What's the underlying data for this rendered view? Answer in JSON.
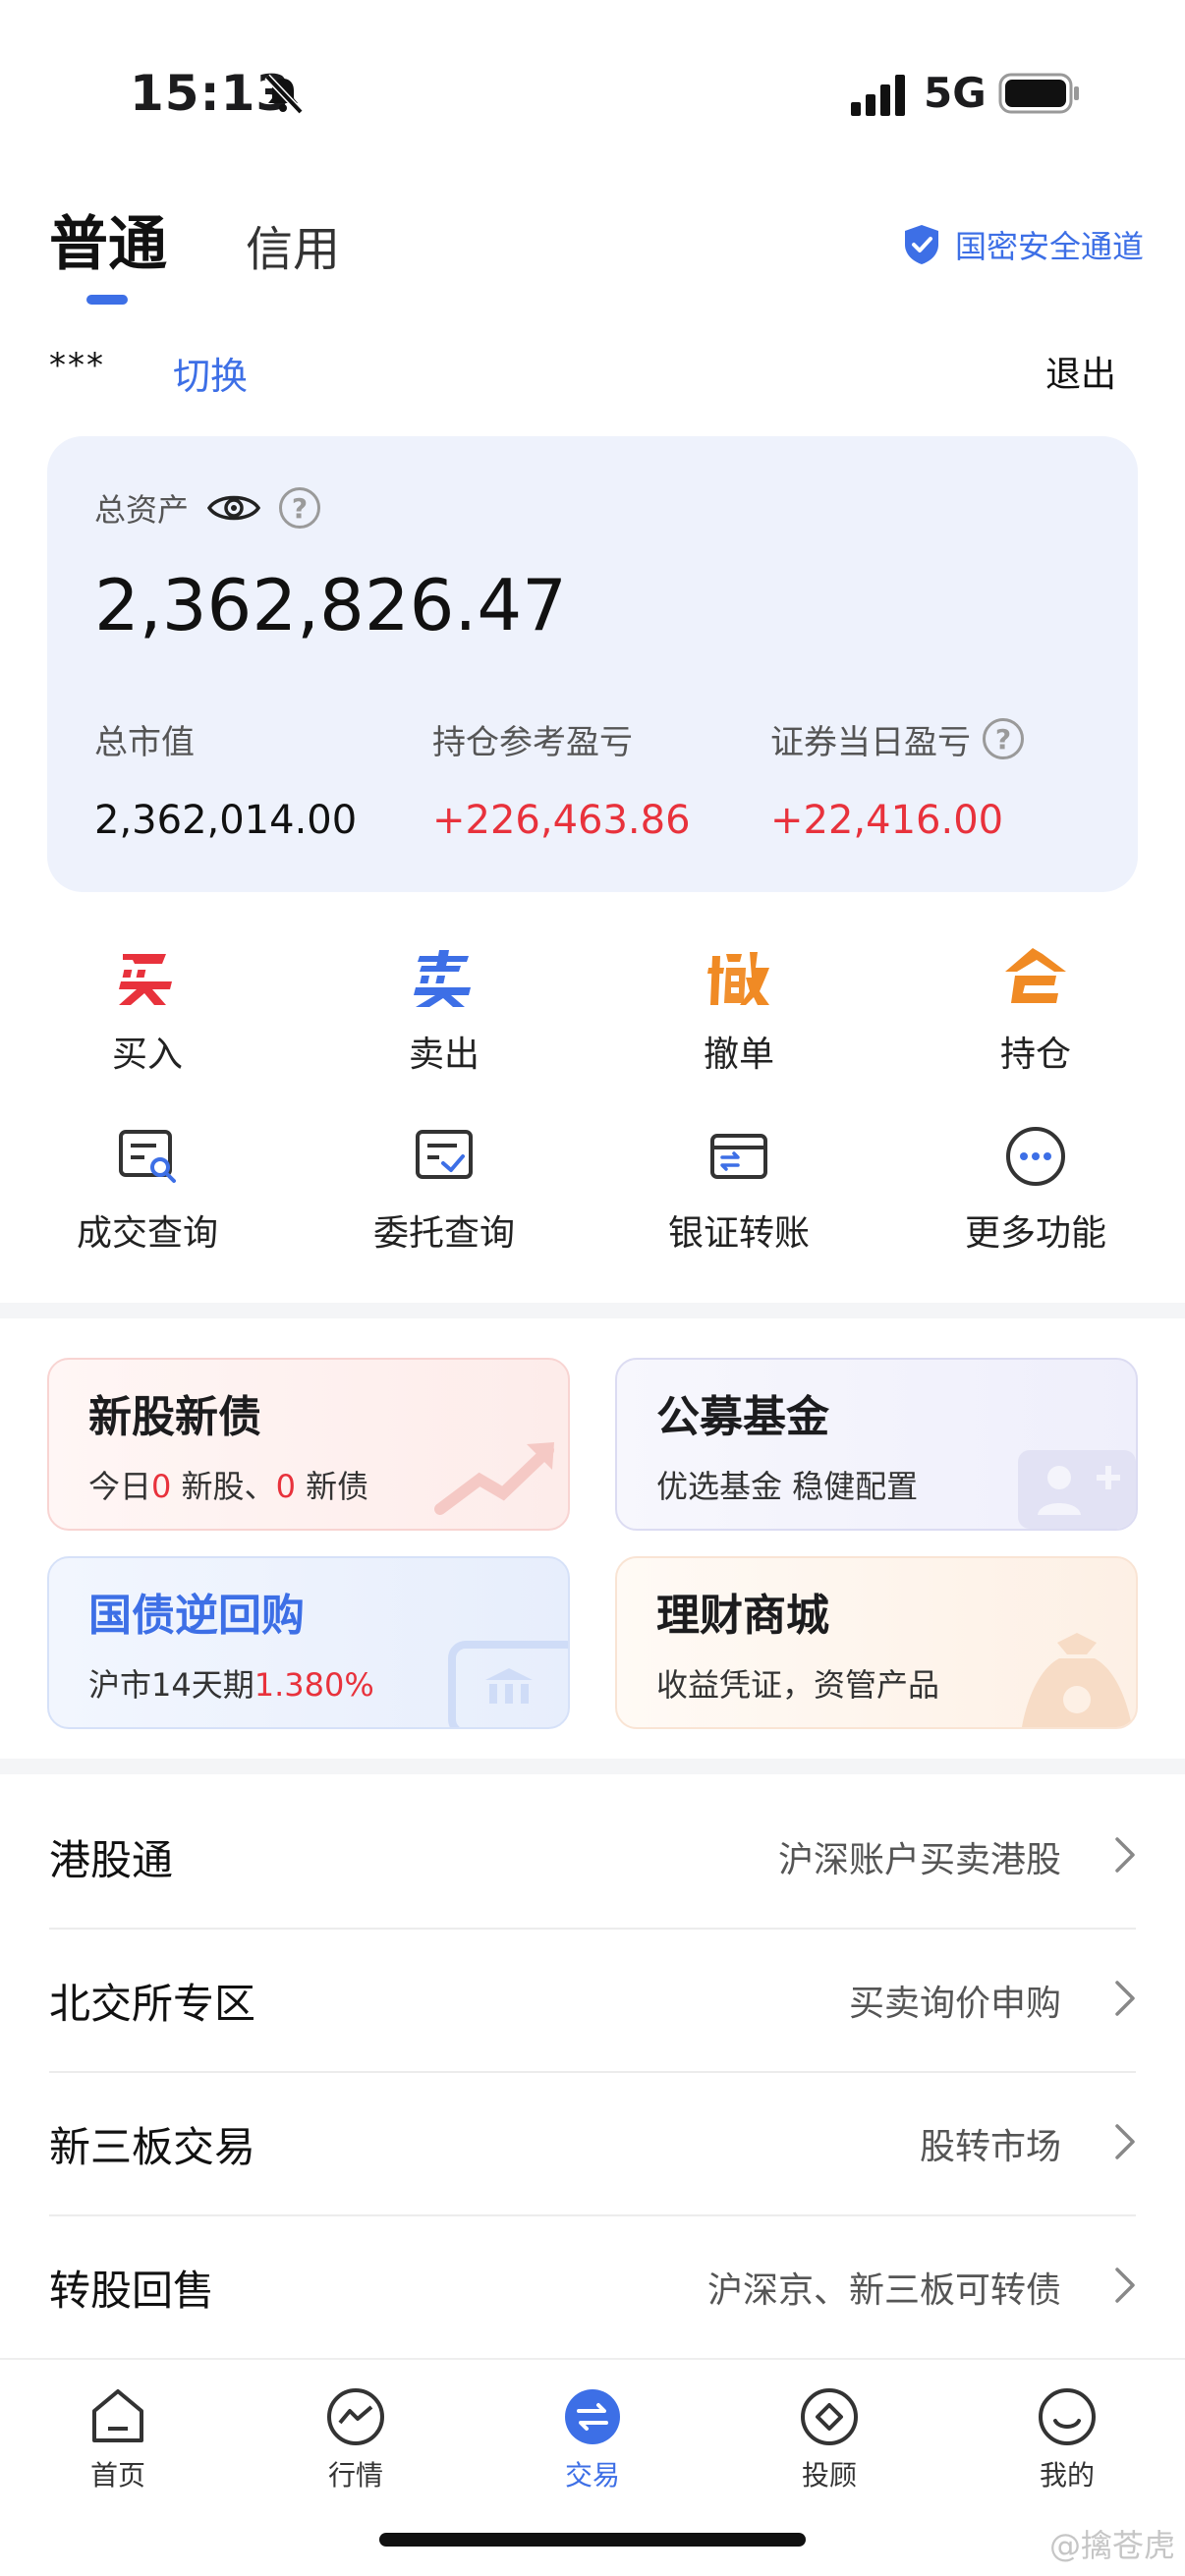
{
  "status_bar": {
    "time": "15:13",
    "network": "5G"
  },
  "tabs": {
    "normal": "普通",
    "credit": "信用"
  },
  "secure_channel": "国密安全通道",
  "account": {
    "masked": "***",
    "switch": "切换",
    "logout": "退出"
  },
  "assets": {
    "total_label": "总资产",
    "total_value": "2,362,826.47",
    "market_value_label": "总市值",
    "market_value": "2,362,014.00",
    "position_pnl_label": "持仓参考盈亏",
    "position_pnl": "+226,463.86",
    "daily_pnl_label": "证券当日盈亏",
    "daily_pnl": "+22,416.00",
    "help": "?"
  },
  "actions_row1": [
    {
      "glyph": "买",
      "label": "买入",
      "color": "#e8323c"
    },
    {
      "glyph": "卖",
      "label": "卖出",
      "color": "#3d6fe6"
    },
    {
      "glyph": "撤",
      "label": "撤单",
      "color": "#f08a24"
    },
    {
      "glyph": "仓",
      "label": "持仓",
      "color": "#f08a24"
    }
  ],
  "actions_row2": [
    {
      "icon": "trade-query-icon",
      "label": "成交查询"
    },
    {
      "icon": "order-query-icon",
      "label": "委托查询"
    },
    {
      "icon": "bank-transfer-icon",
      "label": "银证转账"
    },
    {
      "icon": "more-icon",
      "label": "更多功能"
    }
  ],
  "cards": {
    "ipo": {
      "title": "新股新债",
      "sub_prefix": "今日",
      "stock_count": "0",
      "stock_text": " 新股、",
      "bond_count": "0",
      "bond_text": " 新债"
    },
    "fund": {
      "title": "公募基金",
      "sub": "优选基金 稳健配置"
    },
    "repo": {
      "title": "国债逆回购",
      "sub_prefix": "沪市14天期",
      "rate": "1.380%"
    },
    "mall": {
      "title": "理财商城",
      "sub": "收益凭证，资管产品"
    }
  },
  "list": [
    {
      "label": "港股通",
      "desc": "沪深账户买卖港股"
    },
    {
      "label": "北交所专区",
      "desc": "买卖询价申购"
    },
    {
      "label": "新三板交易",
      "desc": "股转市场"
    },
    {
      "label": "转股回售",
      "desc": "沪深京、新三板可转债"
    }
  ],
  "bottom_nav": [
    {
      "label": "首页",
      "icon": "home-icon"
    },
    {
      "label": "行情",
      "icon": "market-icon"
    },
    {
      "label": "交易",
      "icon": "trade-icon",
      "active": true
    },
    {
      "label": "投顾",
      "icon": "advisor-icon"
    },
    {
      "label": "我的",
      "icon": "profile-icon"
    }
  ],
  "watermark": "@擒苍虎"
}
